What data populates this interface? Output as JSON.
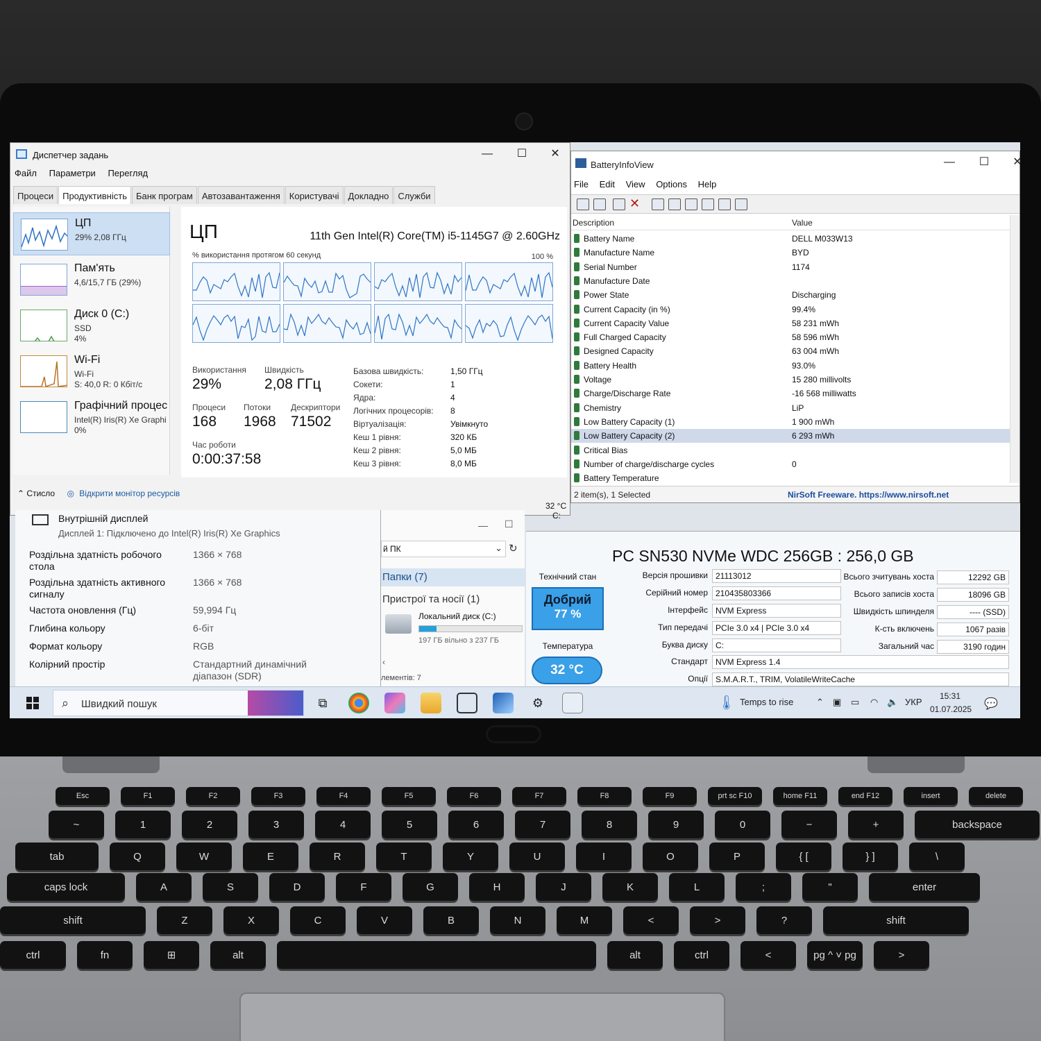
{
  "task_manager": {
    "title": "Диспетчер задань",
    "menu": [
      "Файл",
      "Параметри",
      "Перегляд"
    ],
    "tabs": [
      "Процеси",
      "Продуктивність",
      "Банк програм",
      "Автозавантаження",
      "Користувачі",
      "Докладно",
      "Служби"
    ],
    "active_tab": "Продуктивність",
    "sidebar": [
      {
        "name": "ЦП",
        "sub": "29% 2,08 ГГц"
      },
      {
        "name": "Пам'ять",
        "sub": "4,6/15,7 ГБ (29%)"
      },
      {
        "name": "Диск 0 (C:)",
        "sub": "SSD",
        "sub2": "4%"
      },
      {
        "name": "Wi-Fi",
        "sub": "Wi-Fi",
        "sub2": "S: 40,0 R: 0 Кбіт/с"
      },
      {
        "name": "Графічний процес",
        "sub": "Intel(R) Iris(R) Xe Graphi",
        "sub2": "0%"
      }
    ],
    "heading": "ЦП",
    "cpu_name": "11th Gen Intel(R) Core(TM) i5-1145G7 @ 2.60GHz",
    "graph_label": "% використання протягом 60 секунд",
    "graph_max": "100 %",
    "stats": {
      "usage_label": "Використання",
      "usage": "29%",
      "speed_label": "Швидкість",
      "speed": "2,08 ГГц",
      "processes_label": "Процеси",
      "processes": "168",
      "threads_label": "Потоки",
      "threads": "1968",
      "handles_label": "Дескриптори",
      "handles": "71502",
      "uptime_label": "Час роботи",
      "uptime": "0:00:37:58"
    },
    "details": [
      {
        "label": "Базова швидкість:",
        "value": "1,50 ГГц"
      },
      {
        "label": "Сокети:",
        "value": "1"
      },
      {
        "label": "Ядра:",
        "value": "4"
      },
      {
        "label": "Логічних процесорів:",
        "value": "8"
      },
      {
        "label": "Віртуалізація:",
        "value": "Увімкнуто"
      },
      {
        "label": "Кеш 1 рівня:",
        "value": "320 КБ"
      },
      {
        "label": "Кеш 2 рівня:",
        "value": "5,0 МБ"
      },
      {
        "label": "Кеш 3 рівня:",
        "value": "8,0 МБ"
      }
    ],
    "footer_less": "Стисло",
    "footer_monitor": "Відкрити монітор ресурсів"
  },
  "battery_info_view": {
    "title": "BatteryInfoView",
    "menu": [
      "File",
      "Edit",
      "View",
      "Options",
      "Help"
    ],
    "col_description": "Description",
    "col_value": "Value",
    "rows": [
      {
        "d": "Battery Name",
        "v": "DELL M033W13"
      },
      {
        "d": "Manufacture Name",
        "v": "BYD"
      },
      {
        "d": "Serial Number",
        "v": "1174"
      },
      {
        "d": "Manufacture Date",
        "v": ""
      },
      {
        "d": "Power State",
        "v": "Discharging"
      },
      {
        "d": "Current Capacity (in %)",
        "v": "99.4%"
      },
      {
        "d": "Current Capacity Value",
        "v": "58 231 mWh"
      },
      {
        "d": "Full Charged Capacity",
        "v": "58 596 mWh"
      },
      {
        "d": "Designed Capacity",
        "v": "63 004 mWh"
      },
      {
        "d": "Battery Health",
        "v": "93.0%"
      },
      {
        "d": "Voltage",
        "v": "15 280 millivolts"
      },
      {
        "d": "Charge/Discharge Rate",
        "v": "-16 568 milliwatts"
      },
      {
        "d": "Chemistry",
        "v": "LiP"
      },
      {
        "d": "Low Battery Capacity (1)",
        "v": "1 900 mWh"
      },
      {
        "d": "Low Battery Capacity (2)",
        "v": "6 293 mWh"
      },
      {
        "d": "Critical Bias",
        "v": ""
      },
      {
        "d": "Number of charge/discharge cycles",
        "v": "0"
      },
      {
        "d": "Battery Temperature",
        "v": ""
      }
    ],
    "selected_index": 14,
    "status_items": "2 item(s), 1 Selected",
    "status_credit": "NirSoft Freeware. https://www.nirsoft.net"
  },
  "display_settings": {
    "title": "Внутрішній дисплей",
    "subtitle": "Дисплей 1: Підключено до Intel(R) Iris(R) Xe Graphics",
    "rows": [
      {
        "label": "Роздільна здатність робочого стола",
        "value": "1366 × 768"
      },
      {
        "label": "Роздільна здатність активного сигналу",
        "value": "1366 × 768"
      },
      {
        "label": "Частота оновлення (Гц)",
        "value": "59,994 Гц"
      },
      {
        "label": "Глибина кольору",
        "value": "6-біт"
      },
      {
        "label": "Формат кольору",
        "value": "RGB"
      },
      {
        "label": "Колірний простір",
        "value": "Стандартний динамічний діапазон (SDR)"
      }
    ]
  },
  "explorer": {
    "path": "й ПК",
    "folders": "Папки (7)",
    "devices": "Пристрої та носії (1)",
    "drive_name": "Локальний диск (C:)",
    "drive_free": "197 ГБ вільно з 237 ГБ",
    "drive_used_fraction": 0.17,
    "items": "лементів: 7"
  },
  "crystal_disk": {
    "temp_top": "32 °C",
    "drive_letter_top": "C:",
    "model": "PC SN530 NVMe WDC 256GB : 256,0 GB",
    "health_label": "Технічний стан",
    "health_status": "Добрий",
    "health_pct": "77 %",
    "temp_label": "Температура",
    "temp": "32 °C",
    "left_fields": [
      {
        "label": "Версія прошивки",
        "value": "21113012"
      },
      {
        "label": "Серійний номер",
        "value": "210435803366"
      },
      {
        "label": "Інтерфейс",
        "value": "NVM Express"
      },
      {
        "label": "Тип передачі",
        "value": "PCIe 3.0 x4 | PCIe 3.0 x4"
      },
      {
        "label": "Буква диску",
        "value": "C:"
      }
    ],
    "right_fields": [
      {
        "label": "Всього зчитувань хоста",
        "value": "12292 GB"
      },
      {
        "label": "Всього записів хоста",
        "value": "18096 GB"
      },
      {
        "label": "Швидкість шпинделя",
        "value": "---- (SSD)"
      },
      {
        "label": "К-сть включень",
        "value": "1067 разів"
      },
      {
        "label": "Загальний час",
        "value": "3190 годин"
      }
    ],
    "standard_label": "Стандарт",
    "standard": "NVM Express 1.4",
    "features_label": "Опції",
    "features": "S.M.A.R.T., TRIM, VolatileWriteCache"
  },
  "taskbar": {
    "search_placeholder": "Швидкий пошук",
    "weather": "Temps to rise",
    "language": "УКР",
    "time": "15:31",
    "date": "01.07.2025"
  },
  "keyboard": {
    "fn_row": [
      "Esc",
      "F1",
      "F2",
      "F3",
      "F4",
      "F5",
      "F6",
      "F7",
      "F8",
      "F9",
      "prt sc F10",
      "home F11",
      "end F12",
      "insert",
      "delete"
    ],
    "num_row": [
      "~",
      "1",
      "2",
      "3",
      "4",
      "5",
      "6",
      "7",
      "8",
      "9",
      "0",
      "−",
      "+",
      "backspace"
    ],
    "q_row": [
      "tab",
      "Q",
      "W",
      "E",
      "R",
      "T",
      "Y",
      "U",
      "I",
      "O",
      "P",
      "{ [",
      "} ]",
      "\\"
    ],
    "a_row": [
      "caps lock",
      "A",
      "S",
      "D",
      "F",
      "G",
      "H",
      "J",
      "K",
      "L",
      ";",
      "\"",
      "enter"
    ],
    "z_row": [
      "shift",
      "Z",
      "X",
      "C",
      "V",
      "B",
      "N",
      "M",
      "<",
      ">",
      "?",
      "shift"
    ],
    "bottom_row": [
      "ctrl",
      "fn",
      "⊞",
      "alt",
      "",
      "alt",
      "ctrl",
      "<",
      "pg ^ ˅ pg",
      ">"
    ]
  }
}
